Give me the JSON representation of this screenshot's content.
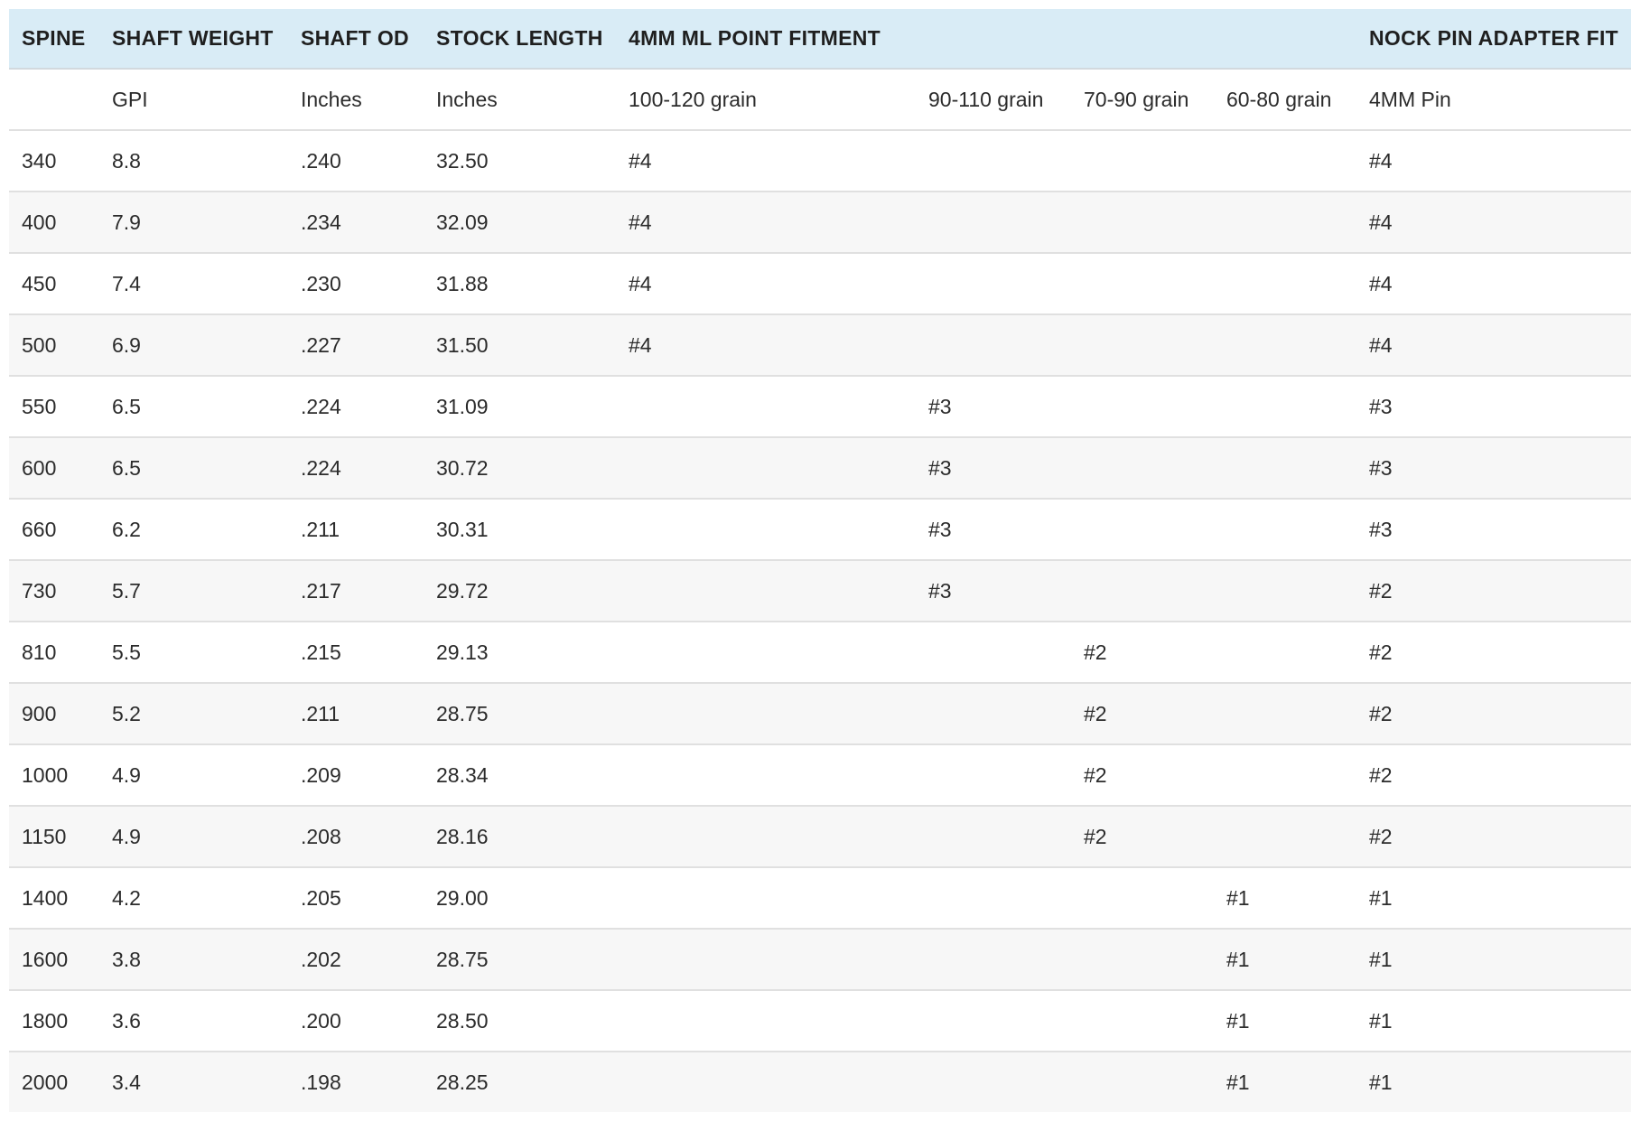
{
  "headers": [
    "SPINE",
    "SHAFT WEIGHT",
    "SHAFT OD",
    "STOCK LENGTH",
    "4MM ML POINT FITMENT",
    "",
    "",
    "",
    "NOCK PIN ADAPTER FIT"
  ],
  "units": [
    "",
    "GPI",
    "Inches",
    "Inches",
    "100-120 grain",
    "90-110 grain",
    "70-90 grain",
    "60-80 grain",
    "4MM Pin"
  ],
  "rows": [
    [
      "340",
      "8.8",
      ".240",
      "32.50",
      "#4",
      "",
      "",
      "",
      "#4"
    ],
    [
      "400",
      "7.9",
      ".234",
      "32.09",
      "#4",
      "",
      "",
      "",
      "#4"
    ],
    [
      "450",
      "7.4",
      ".230",
      "31.88",
      "#4",
      "",
      "",
      "",
      "#4"
    ],
    [
      "500",
      "6.9",
      ".227",
      "31.50",
      "#4",
      "",
      "",
      "",
      "#4"
    ],
    [
      "550",
      "6.5",
      ".224",
      "31.09",
      "",
      "#3",
      "",
      "",
      "#3"
    ],
    [
      "600",
      "6.5",
      ".224",
      "30.72",
      "",
      "#3",
      "",
      "",
      "#3"
    ],
    [
      "660",
      "6.2",
      ".211",
      "30.31",
      "",
      "#3",
      "",
      "",
      "#3"
    ],
    [
      "730",
      "5.7",
      ".217",
      "29.72",
      "",
      "#3",
      "",
      "",
      "#2"
    ],
    [
      "810",
      "5.5",
      ".215",
      "29.13",
      "",
      "",
      "#2",
      "",
      "#2"
    ],
    [
      "900",
      "5.2",
      ".211",
      "28.75",
      "",
      "",
      "#2",
      "",
      "#2"
    ],
    [
      "1000",
      "4.9",
      ".209",
      "28.34",
      "",
      "",
      "#2",
      "",
      "#2"
    ],
    [
      "1150",
      "4.9",
      ".208",
      "28.16",
      "",
      "",
      "#2",
      "",
      "#2"
    ],
    [
      "1400",
      "4.2",
      ".205",
      "29.00",
      "",
      "",
      "",
      "#1",
      "#1"
    ],
    [
      "1600",
      "3.8",
      ".202",
      "28.75",
      "",
      "",
      "",
      "#1",
      "#1"
    ],
    [
      "1800",
      "3.6",
      ".200",
      "28.50",
      "",
      "",
      "",
      "#1",
      "#1"
    ],
    [
      "2000",
      "3.4",
      ".198",
      "28.25",
      "",
      "",
      "",
      "#1",
      "#1"
    ]
  ],
  "colors": {
    "header_bg": "#d9ecf6",
    "row_alt_bg": "#f7f7f7",
    "row_bg": "#ffffff",
    "divider": "#e0e0e0"
  }
}
